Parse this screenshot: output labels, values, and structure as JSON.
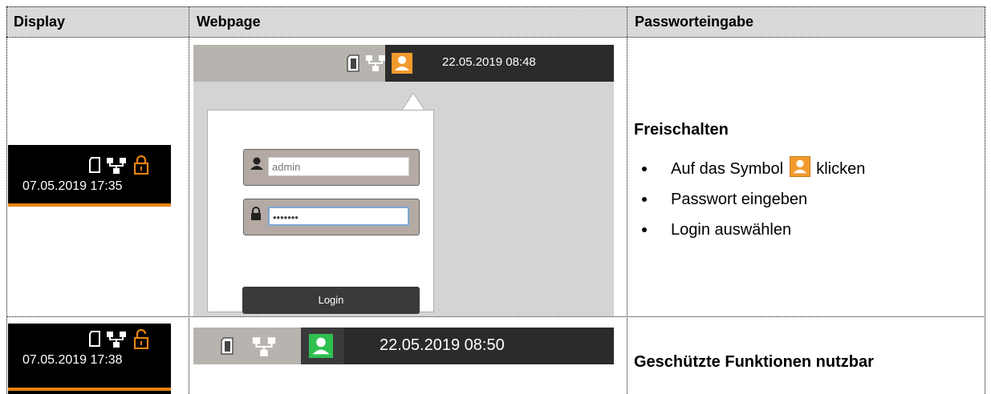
{
  "table": {
    "headers": [
      "Display",
      "Webpage",
      "Passworteingabe"
    ]
  },
  "row1": {
    "display_datetime": "07.05.2019  17:35",
    "web_datetime": "22.05.2019   08:48",
    "username_value": "admin",
    "password_value": "•••••••",
    "login_label": "Login",
    "section_title": "Freischalten",
    "steps": {
      "s1_pre": "Auf das Symbol",
      "s1_post": "klicken",
      "s2": "Passwort eingeben",
      "s3": "Login auswählen"
    }
  },
  "row2": {
    "display_datetime": "07.05.2019  17:38",
    "web_datetime": "22.05.2019   08:50",
    "section_title": "Geschützte Funktionen nutzbar"
  },
  "colors": {
    "accent_orange": "#f29a2e",
    "unlocked_green": "#2fbf4f",
    "header_gray": "#d9d9d9"
  },
  "icons": [
    "sd-card-icon",
    "network-icon",
    "user-icon",
    "lock-icon",
    "unlock-icon"
  ]
}
